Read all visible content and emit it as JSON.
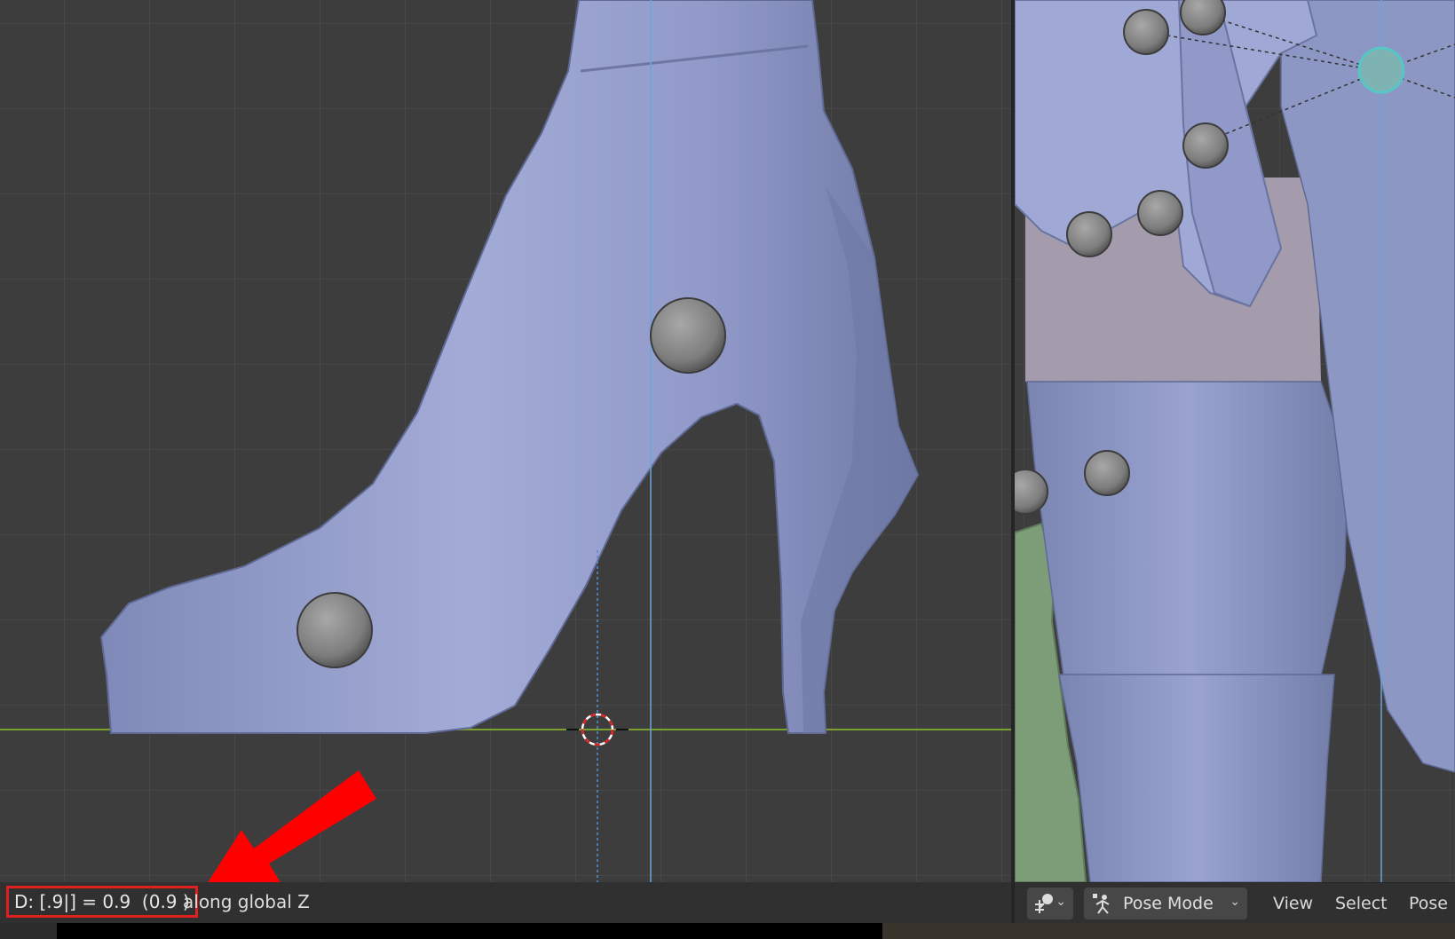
{
  "left_viewport": {
    "status": {
      "value_text": "D: [.9|] = 0.9  (0.9 )",
      "suffix_text": "along global Z"
    }
  },
  "right_viewport": {
    "header": {
      "orientation_icon": "transform-orientation-icon",
      "mode": {
        "icon": "pose-mode-armature-icon",
        "label": "Pose Mode"
      },
      "menus": {
        "view": "View",
        "select": "Select",
        "pose": "Pose"
      }
    }
  },
  "annotations": {
    "highlight_color": "#e0201f",
    "arrow_color": "#ff0000"
  },
  "colors": {
    "viewport_bg": "#3d3d3d",
    "grid_line": "#474747",
    "mesh_body": "#8c97c4",
    "bone_sphere": "#8a8a8a",
    "selected_bone": "#56c6c6",
    "y_axis_line": "#6aa5d8",
    "ground_line": "#7aa030"
  }
}
